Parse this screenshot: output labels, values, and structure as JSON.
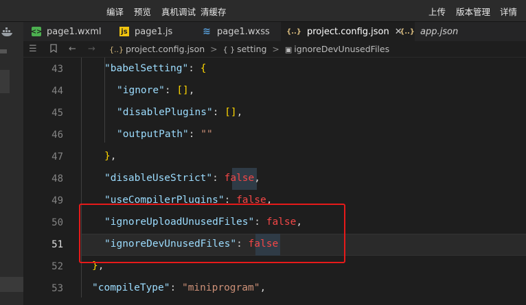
{
  "toolbar": {
    "compile_label": "编译",
    "preview_label": "预览",
    "real_device_debug_label": "真机调试",
    "clear_cache_label": "清缓存",
    "upload_label": "上传",
    "version_mgmt_label": "版本管理",
    "details_label": "详情"
  },
  "tabs": [
    {
      "label": "page1.wxml",
      "icon": "wxml-file-icon",
      "color": "#4caf50"
    },
    {
      "label": "page1.js",
      "icon": "js-file-icon",
      "color": "#f1c40f"
    },
    {
      "label": "page1.wxss",
      "icon": "wxss-file-icon",
      "color": "#569cd6"
    },
    {
      "label": "project.config.json",
      "icon": "json-file-icon",
      "color": "#d7ba7d",
      "active": true
    },
    {
      "label": "app.json",
      "icon": "json-file-icon",
      "color": "#d7ba7d",
      "italic": true
    }
  ],
  "tab_close_glyph": "✕",
  "breadcrumb": {
    "file": "project.config.json",
    "object": "setting",
    "property": "ignoreDevUnusedFiles",
    "json_glyph": "{..}",
    "object_glyph": "{ }",
    "separator": ">"
  },
  "editor": {
    "current_line": 51,
    "lines": [
      {
        "n": "43",
        "parts": [
          [
            "key",
            "\"babelSetting\""
          ],
          [
            "pun",
            ": "
          ],
          [
            "brk",
            "{"
          ]
        ]
      },
      {
        "n": "44",
        "parts": [
          [
            "key",
            "\"ignore\""
          ],
          [
            "pun",
            ": "
          ],
          [
            "brk",
            "[]"
          ],
          [
            "pun",
            ","
          ]
        ]
      },
      {
        "n": "45",
        "parts": [
          [
            "key",
            "\"disablePlugins\""
          ],
          [
            "pun",
            ": "
          ],
          [
            "brk",
            "[]"
          ],
          [
            "pun",
            ","
          ]
        ]
      },
      {
        "n": "46",
        "parts": [
          [
            "key",
            "\"outputPath\""
          ],
          [
            "pun",
            ": "
          ],
          [
            "str",
            "\"\""
          ]
        ]
      },
      {
        "n": "47",
        "parts": [
          [
            "brk",
            "}"
          ],
          [
            "pun",
            ","
          ]
        ]
      },
      {
        "n": "48",
        "parts": [
          [
            "key",
            "\"disableUseStrict\""
          ],
          [
            "pun",
            ": "
          ],
          [
            "kw",
            "false"
          ],
          [
            "pun",
            ","
          ]
        ]
      },
      {
        "n": "49",
        "parts": [
          [
            "key",
            "\"useCompilerPlugins\""
          ],
          [
            "pun",
            ": "
          ],
          [
            "kw",
            "false"
          ],
          [
            "pun",
            ","
          ]
        ]
      },
      {
        "n": "50",
        "parts": [
          [
            "key",
            "\"ignoreUploadUnusedFiles\""
          ],
          [
            "pun",
            ": "
          ],
          [
            "kw",
            "false"
          ],
          [
            "pun",
            ","
          ]
        ]
      },
      {
        "n": "51",
        "parts": [
          [
            "key",
            "\"ignoreDevUnusedFiles\""
          ],
          [
            "pun",
            ": "
          ],
          [
            "kw",
            "false"
          ]
        ]
      },
      {
        "n": "52",
        "parts": [
          [
            "brk",
            "}"
          ],
          [
            "pun",
            ","
          ]
        ]
      },
      {
        "n": "53",
        "parts": [
          [
            "key",
            "\"compileType\""
          ],
          [
            "pun",
            ": "
          ],
          [
            "str",
            "\"miniprogram\""
          ],
          [
            "pun",
            ","
          ]
        ]
      }
    ]
  }
}
